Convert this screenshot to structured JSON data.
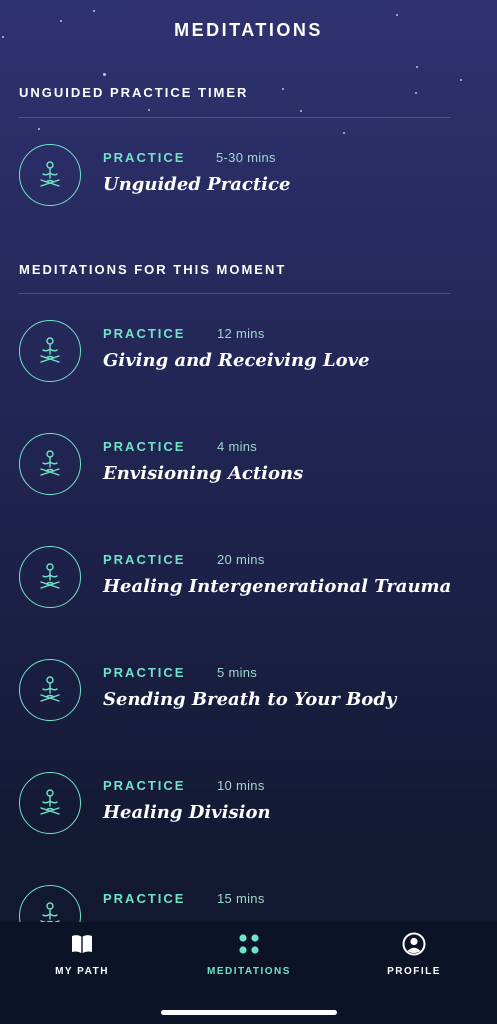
{
  "header": {
    "title": "MEDITATIONS"
  },
  "sections": {
    "unguided": {
      "heading": "UNGUIDED PRACTICE TIMER"
    },
    "moment": {
      "heading": "MEDITATIONS FOR THIS MOMENT"
    }
  },
  "items": [
    {
      "tag": "PRACTICE",
      "duration": "5-30 mins",
      "title": "Unguided Practice"
    },
    {
      "tag": "PRACTICE",
      "duration": "12 mins",
      "title": "Giving and Receiving Love"
    },
    {
      "tag": "PRACTICE",
      "duration": "4 mins",
      "title": "Envisioning Actions"
    },
    {
      "tag": "PRACTICE",
      "duration": "20 mins",
      "title": "Healing Intergenerational Trauma"
    },
    {
      "tag": "PRACTICE",
      "duration": "5 mins",
      "title": "Sending Breath to Your Body"
    },
    {
      "tag": "PRACTICE",
      "duration": "10 mins",
      "title": "Healing Division"
    },
    {
      "tag": "PRACTICE",
      "duration": "15 mins",
      "title": ""
    }
  ],
  "tabs": [
    {
      "label": "MY PATH",
      "icon": "book-icon"
    },
    {
      "label": "MEDITATIONS",
      "icon": "grid-dots-icon"
    },
    {
      "label": "PROFILE",
      "icon": "profile-icon"
    }
  ],
  "colors": {
    "accent": "#6fe3c6",
    "background_top": "#2f3270",
    "background_bottom": "#0f1629"
  }
}
